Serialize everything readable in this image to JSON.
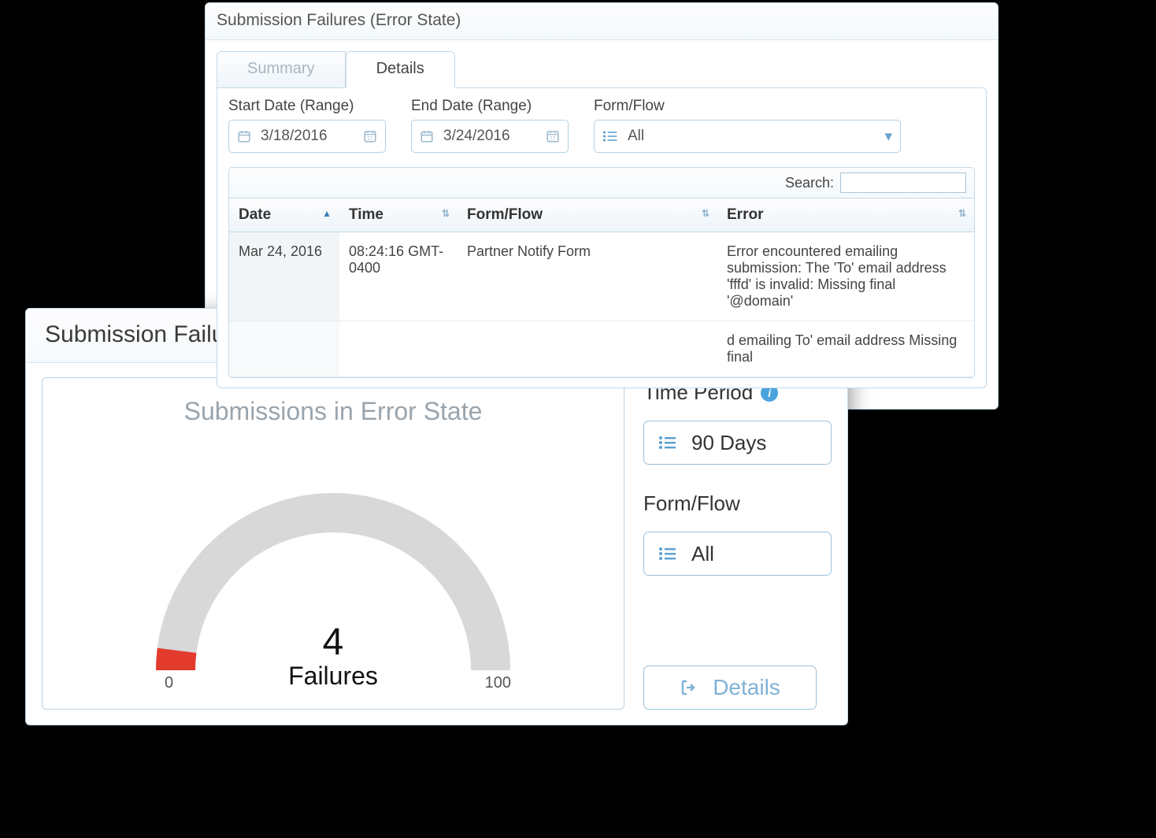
{
  "back_panel": {
    "title": "Submission Failures (Error State)",
    "tabs": {
      "summary": "Summary",
      "details": "Details",
      "active": "details"
    },
    "filters": {
      "start_label": "Start Date (Range)",
      "start_value": "3/18/2016",
      "end_label": "End Date (Range)",
      "end_value": "3/24/2016",
      "formflow_label": "Form/Flow",
      "formflow_value": "All"
    },
    "search_label": "Search:",
    "columns": [
      "Date",
      "Time",
      "Form/Flow",
      "Error"
    ],
    "sorted_column_index": 0,
    "rows": [
      {
        "date": "Mar 24, 2016",
        "time": "08:24:16 GMT-0400",
        "formflow": "Partner Notify Form",
        "error": "Error encountered emailing submission: The 'To' email address 'fffd' is invalid: Missing final '@domain'"
      },
      {
        "date": "",
        "time": "",
        "formflow": "",
        "error": "d emailing To' email address Missing final"
      }
    ]
  },
  "front_panel": {
    "title": "Submission Failures (Error State)",
    "gauge_title": "Submissions in Error State",
    "gauge_min": "0",
    "gauge_max": "100",
    "gauge_value_label": "4",
    "gauge_unit": "Failures",
    "time_period_label": "Time Period",
    "time_period_value": "90 Days",
    "formflow_label": "Form/Flow",
    "formflow_value": "All",
    "details_button": "Details"
  },
  "chart_data": {
    "type": "gauge",
    "title": "Submissions in Error State",
    "value": 4,
    "min": 0,
    "max": 100,
    "unit": "Failures",
    "fill_fraction": 0.04,
    "colors": {
      "track": "#d8d8d8",
      "fill": "#e23b2e"
    }
  }
}
